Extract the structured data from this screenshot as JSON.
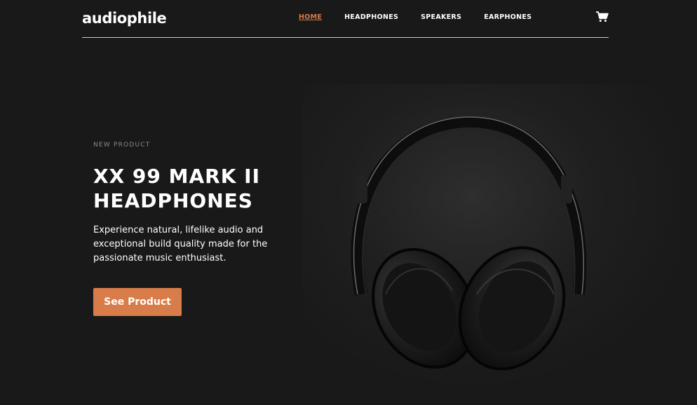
{
  "header": {
    "logo": "audiophile",
    "nav": [
      {
        "label": "HOME",
        "active": true
      },
      {
        "label": "HEADPHONES",
        "active": false
      },
      {
        "label": "SPEAKERS",
        "active": false
      },
      {
        "label": "EARPHONES",
        "active": false
      }
    ],
    "cart_icon": "cart-icon"
  },
  "hero": {
    "eyebrow": "NEW PRODUCT",
    "title_line1": "XX 99 MARK II",
    "title_line2": "HEADPHONES",
    "description": "Experience natural, lifelike audio and exceptional build quality made for the passionate music enthusiast.",
    "cta_label": "See Product",
    "image": "headphones-image"
  },
  "colors": {
    "background": "#191919",
    "accent": "#d87d4a",
    "text": "#ffffff",
    "muted": "#8a8a8a"
  }
}
